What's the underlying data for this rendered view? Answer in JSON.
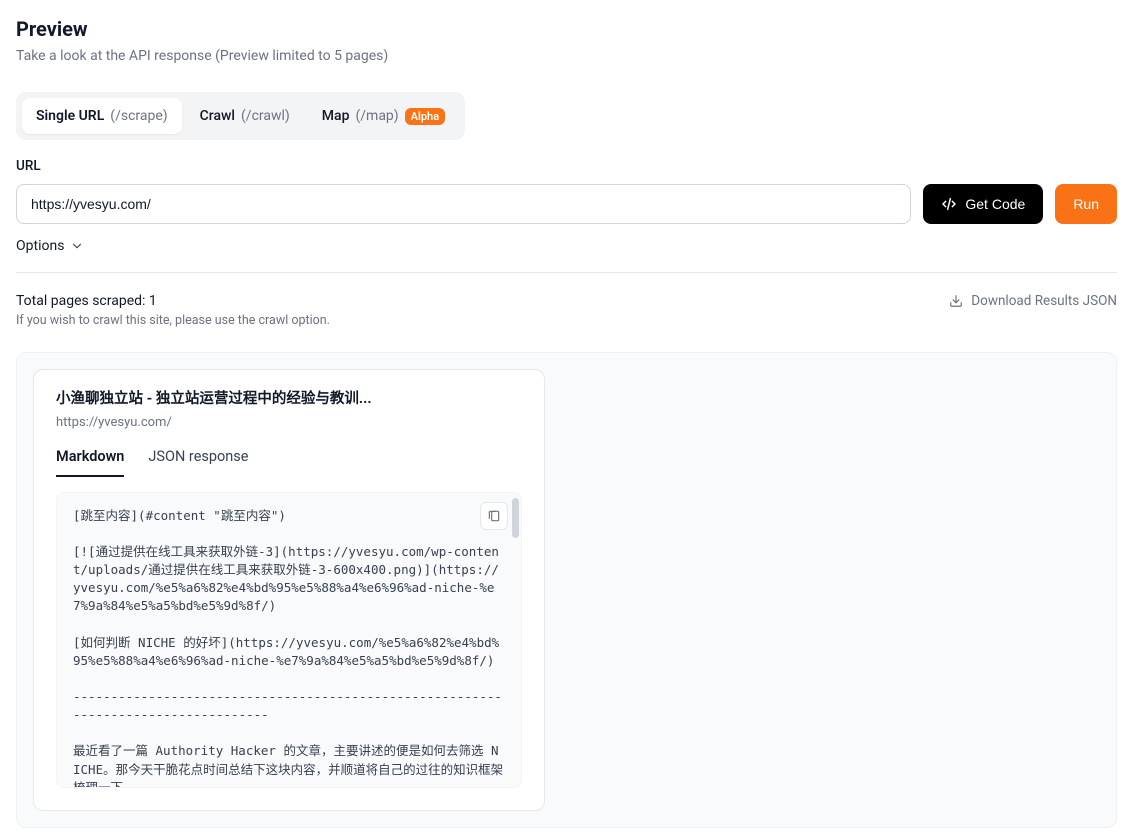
{
  "header": {
    "title": "Preview",
    "subtitle": "Take a look at the API response (Preview limited to 5 pages)"
  },
  "tabs": [
    {
      "label": "Single URL",
      "api": "(/scrape)",
      "active": true
    },
    {
      "label": "Crawl",
      "api": "(/crawl)",
      "active": false
    },
    {
      "label": "Map",
      "api": "(/map)",
      "active": false,
      "badge": "Alpha"
    }
  ],
  "form": {
    "url_label": "URL",
    "url_value": "https://yvesyu.com/",
    "get_code_label": "Get Code",
    "run_label": "Run",
    "options_label": "Options"
  },
  "results": {
    "count_label": "Total pages scraped: ",
    "count_value": "1",
    "hint": "If you wish to crawl this site, please use the crawl option.",
    "download_label": "Download Results JSON"
  },
  "card": {
    "title": "小渔聊独立站 - 独立站运营过程中的经验与教训...",
    "url": "https://yvesyu.com/",
    "inner_tabs": {
      "markdown": "Markdown",
      "json": "JSON response"
    },
    "markdown": "[跳至内容](#content \"跳至内容\")\n\n[![通过提供在线工具来获取外链-3](https://yvesyu.com/wp-content/uploads/通过提供在线工具来获取外链-3-600x400.png)](https://yvesyu.com/%e5%a6%82%e4%bd%95%e5%88%a4%e6%96%ad-niche-%e7%9a%84%e5%a5%bd%e5%9d%8f/)\n\n[如何判断 NICHE 的好坏](https://yvesyu.com/%e5%a6%82%e4%bd%95%e5%88%a4%e6%96%ad-niche-%e7%9a%84%e5%a5%bd%e5%9d%8f/)\n\n-----------------------------------------------------------------------------------\n\n最近看了一篇 Authority Hacker 的文章，主要讲述的便是如何去筛选 NICHE。那今天干脆花点时间总结下这块内容，并顺道将自己的过往的知识框架梳理一下。"
  }
}
